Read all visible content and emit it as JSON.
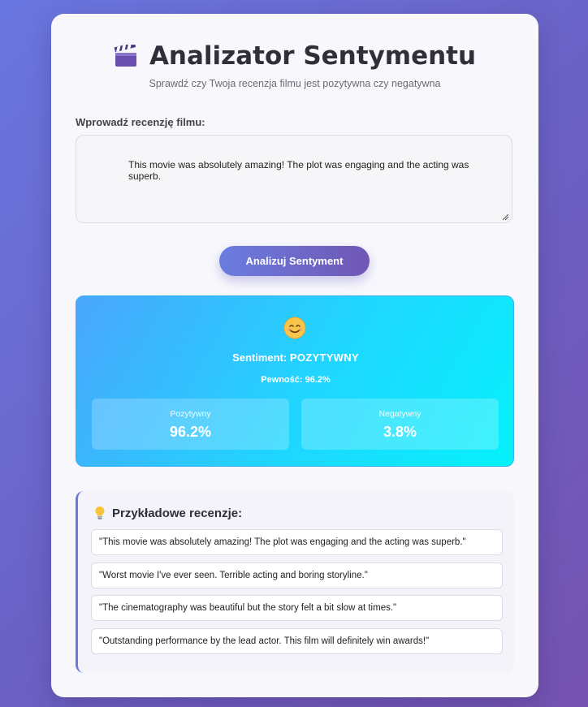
{
  "header": {
    "icon": "clapperboard-icon",
    "title": "Analizator Sentymentu",
    "subtitle": "Sprawdź czy Twoja recenzja filmu jest pozytywna czy negatywna"
  },
  "form": {
    "label": "Wprowadź recenzję filmu:",
    "review_value": "This movie was absolutely amazing! The plot was engaging and the acting was superb.",
    "submit_label": "Analizuj Sentyment"
  },
  "result": {
    "emoji": "smiling-face-icon",
    "sentiment_label": "Sentiment:",
    "sentiment_value": "POZYTYWNY",
    "confidence_text": "Pewność: 96.2%",
    "positive_label": "Pozytywny",
    "positive_value": "96.2%",
    "negative_label": "Negatywny",
    "negative_value": "3.8%"
  },
  "examples": {
    "icon": "lightbulb-icon",
    "title": "Przykładowe recenzje:",
    "items": [
      "\"This movie was absolutely amazing! The plot was engaging and the acting was superb.\"",
      "\"Worst movie I've ever seen. Terrible acting and boring storyline.\"",
      "\"The cinematography was beautiful but the story felt a bit slow at times.\"",
      "\"Outstanding performance by the lead actor. This film will definitely win awards!\""
    ]
  },
  "colors": {
    "background_start": "#6a77e0",
    "background_end": "#7552b0",
    "button_start": "#6a7de0",
    "button_end": "#7057b4",
    "result_start": "#4aa6fc",
    "result_end": "#06f2fc",
    "accent_border": "#6c7ad8"
  }
}
